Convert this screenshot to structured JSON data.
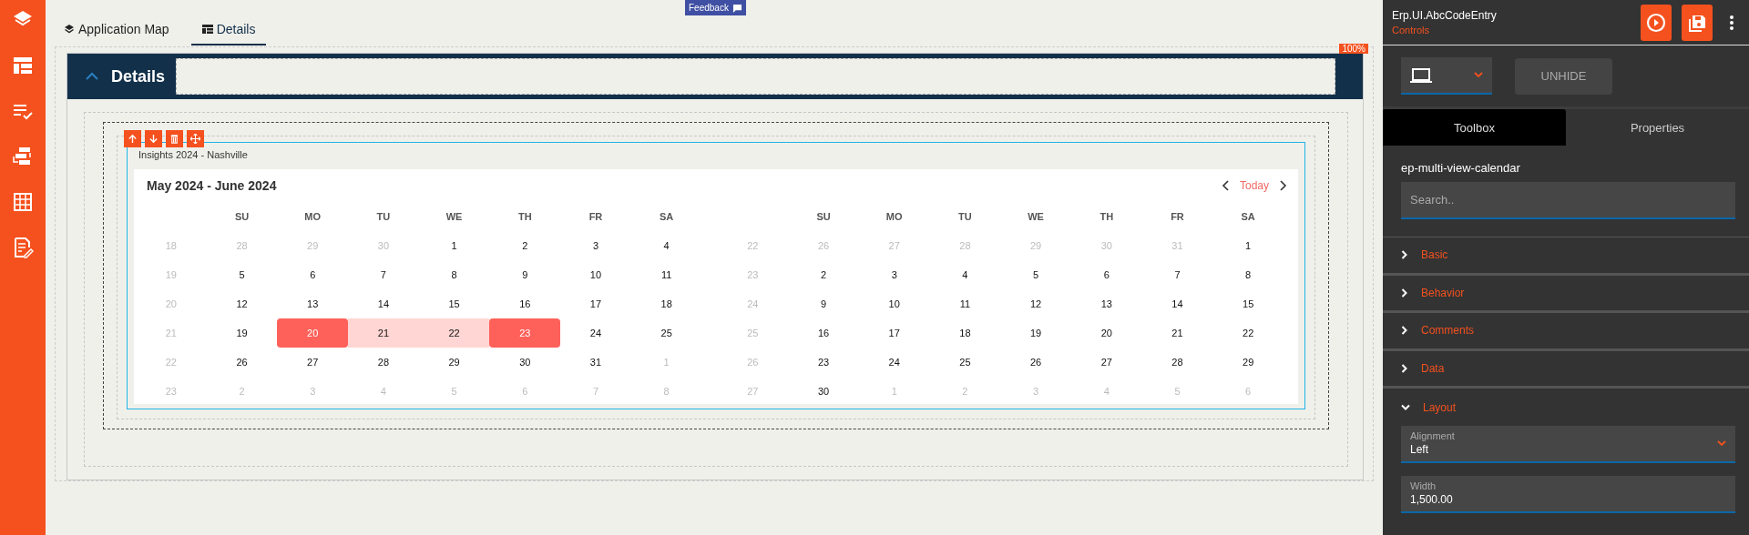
{
  "tabs": [
    {
      "kind": "map",
      "label": "Application Map",
      "selected": false
    },
    {
      "kind": "page",
      "label": "Details",
      "selected": true
    }
  ],
  "feedback": {
    "label": "Feedback"
  },
  "details": {
    "title": "Details",
    "expanded": true,
    "zoom": "100%"
  },
  "control": {
    "title": "Insights 2024 - Nashville"
  },
  "calendar": {
    "title": "May 2024 - June 2024",
    "today": "Today",
    "months": [
      {
        "weekdays": [
          "SU",
          "MO",
          "TU",
          "WE",
          "TH",
          "FR",
          "SA"
        ],
        "weeks": [
          {
            "week": "18",
            "days": [
              {
                "label": "28",
                "muted": true,
                "selected": false
              },
              {
                "label": "29",
                "muted": true,
                "selected": false
              },
              {
                "label": "30",
                "muted": true,
                "selected": false
              },
              {
                "label": "1",
                "muted": false,
                "selected": false
              },
              {
                "label": "2",
                "muted": false,
                "selected": false
              },
              {
                "label": "3",
                "muted": false,
                "selected": false
              },
              {
                "label": "4",
                "muted": false,
                "selected": false
              }
            ]
          },
          {
            "week": "19",
            "days": [
              {
                "label": "5",
                "muted": false,
                "selected": false
              },
              {
                "label": "6",
                "muted": false,
                "selected": false
              },
              {
                "label": "7",
                "muted": false,
                "selected": false
              },
              {
                "label": "8",
                "muted": false,
                "selected": false
              },
              {
                "label": "9",
                "muted": false,
                "selected": false
              },
              {
                "label": "10",
                "muted": false,
                "selected": false
              },
              {
                "label": "11",
                "muted": false,
                "selected": false
              }
            ]
          },
          {
            "week": "20",
            "days": [
              {
                "label": "12",
                "muted": false,
                "selected": false
              },
              {
                "label": "13",
                "muted": false,
                "selected": false
              },
              {
                "label": "14",
                "muted": false,
                "selected": false
              },
              {
                "label": "15",
                "muted": false,
                "selected": false
              },
              {
                "label": "16",
                "muted": false,
                "selected": false
              },
              {
                "label": "17",
                "muted": false,
                "selected": false
              },
              {
                "label": "18",
                "muted": false,
                "selected": false
              }
            ]
          },
          {
            "week": "21",
            "days": [
              {
                "label": "19",
                "muted": false,
                "selected": false
              },
              {
                "label": "20",
                "muted": false,
                "selected": true
              },
              {
                "label": "21",
                "muted": false,
                "selected": false,
                "in_range": true
              },
              {
                "label": "22",
                "muted": false,
                "selected": false,
                "in_range": true
              },
              {
                "label": "23",
                "muted": false,
                "selected": true
              },
              {
                "label": "24",
                "muted": false,
                "selected": false
              },
              {
                "label": "25",
                "muted": false,
                "selected": false
              }
            ]
          },
          {
            "week": "22",
            "days": [
              {
                "label": "26",
                "muted": false,
                "selected": false
              },
              {
                "label": "27",
                "muted": false,
                "selected": false
              },
              {
                "label": "28",
                "muted": false,
                "selected": false
              },
              {
                "label": "29",
                "muted": false,
                "selected": false
              },
              {
                "label": "30",
                "muted": false,
                "selected": false
              },
              {
                "label": "31",
                "muted": false,
                "selected": false
              },
              {
                "label": "1",
                "muted": true,
                "selected": false
              }
            ]
          },
          {
            "week": "23",
            "days": [
              {
                "label": "2",
                "muted": true,
                "selected": false
              },
              {
                "label": "3",
                "muted": true,
                "selected": false
              },
              {
                "label": "4",
                "muted": true,
                "selected": false
              },
              {
                "label": "5",
                "muted": true,
                "selected": false
              },
              {
                "label": "6",
                "muted": true,
                "selected": false
              },
              {
                "label": "7",
                "muted": true,
                "selected": false
              },
              {
                "label": "8",
                "muted": true,
                "selected": false
              }
            ]
          }
        ]
      },
      {
        "weekdays": [
          "SU",
          "MO",
          "TU",
          "WE",
          "TH",
          "FR",
          "SA"
        ],
        "weeks": [
          {
            "week": "22",
            "days": [
              {
                "label": "26",
                "muted": true,
                "selected": false
              },
              {
                "label": "27",
                "muted": true,
                "selected": false
              },
              {
                "label": "28",
                "muted": true,
                "selected": false
              },
              {
                "label": "29",
                "muted": true,
                "selected": false
              },
              {
                "label": "30",
                "muted": true,
                "selected": false
              },
              {
                "label": "31",
                "muted": true,
                "selected": false
              },
              {
                "label": "1",
                "muted": false,
                "selected": false
              }
            ]
          },
          {
            "week": "23",
            "days": [
              {
                "label": "2",
                "muted": false,
                "selected": false
              },
              {
                "label": "3",
                "muted": false,
                "selected": false
              },
              {
                "label": "4",
                "muted": false,
                "selected": false
              },
              {
                "label": "5",
                "muted": false,
                "selected": false
              },
              {
                "label": "6",
                "muted": false,
                "selected": false
              },
              {
                "label": "7",
                "muted": false,
                "selected": false
              },
              {
                "label": "8",
                "muted": false,
                "selected": false
              }
            ]
          },
          {
            "week": "24",
            "days": [
              {
                "label": "9",
                "muted": false,
                "selected": false
              },
              {
                "label": "10",
                "muted": false,
                "selected": false
              },
              {
                "label": "11",
                "muted": false,
                "selected": false
              },
              {
                "label": "12",
                "muted": false,
                "selected": false
              },
              {
                "label": "13",
                "muted": false,
                "selected": false
              },
              {
                "label": "14",
                "muted": false,
                "selected": false
              },
              {
                "label": "15",
                "muted": false,
                "selected": false
              }
            ]
          },
          {
            "week": "25",
            "days": [
              {
                "label": "16",
                "muted": false,
                "selected": false
              },
              {
                "label": "17",
                "muted": false,
                "selected": false
              },
              {
                "label": "18",
                "muted": false,
                "selected": false
              },
              {
                "label": "19",
                "muted": false,
                "selected": false
              },
              {
                "label": "20",
                "muted": false,
                "selected": false
              },
              {
                "label": "21",
                "muted": false,
                "selected": false
              },
              {
                "label": "22",
                "muted": false,
                "selected": false
              }
            ]
          },
          {
            "week": "26",
            "days": [
              {
                "label": "23",
                "muted": false,
                "selected": false
              },
              {
                "label": "24",
                "muted": false,
                "selected": false
              },
              {
                "label": "25",
                "muted": false,
                "selected": false
              },
              {
                "label": "26",
                "muted": false,
                "selected": false
              },
              {
                "label": "27",
                "muted": false,
                "selected": false
              },
              {
                "label": "28",
                "muted": false,
                "selected": false
              },
              {
                "label": "29",
                "muted": false,
                "selected": false
              }
            ]
          },
          {
            "week": "27",
            "days": [
              {
                "label": "30",
                "muted": false,
                "selected": false
              },
              {
                "label": "1",
                "muted": true,
                "selected": false
              },
              {
                "label": "2",
                "muted": true,
                "selected": false
              },
              {
                "label": "3",
                "muted": true,
                "selected": false
              },
              {
                "label": "4",
                "muted": true,
                "selected": false
              },
              {
                "label": "5",
                "muted": true,
                "selected": false
              },
              {
                "label": "6",
                "muted": true,
                "selected": false
              }
            ]
          }
        ]
      }
    ]
  },
  "panel": {
    "title": "Erp.UI.AbcCodeEntry",
    "subtitle": "Controls",
    "unhide": "UNHIDE",
    "tabs": [
      {
        "label": "Toolbox",
        "selected": true
      },
      {
        "label": "Properties",
        "selected": false
      }
    ],
    "component": "ep-multi-view-calendar",
    "search": {
      "placeholder": "Search.."
    },
    "sections": [
      {
        "label": "Basic",
        "expanded": false
      },
      {
        "label": "Behavior",
        "expanded": false
      },
      {
        "label": "Comments",
        "expanded": false
      },
      {
        "label": "Data",
        "expanded": false
      },
      {
        "label": "Layout",
        "expanded": true
      }
    ],
    "fields": [
      {
        "kind": "select",
        "label": "Alignment",
        "value": "Left"
      },
      {
        "kind": "number",
        "label": "Width",
        "value": "1,500.00"
      }
    ]
  }
}
